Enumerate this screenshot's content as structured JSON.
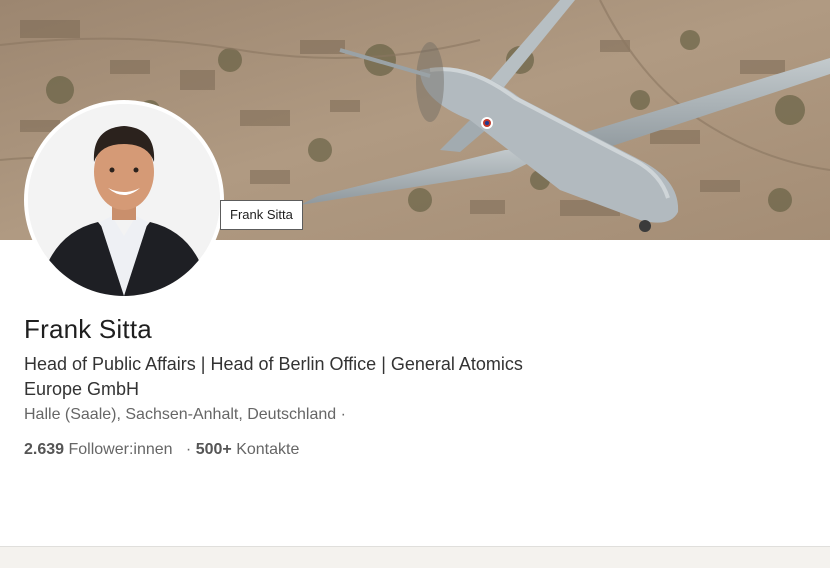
{
  "tooltip": {
    "text": "Frank Sitta"
  },
  "profile": {
    "name": "Frank Sitta",
    "headline": "Head of Public Affairs | Head of Berlin Office | General Atomics Europe GmbH",
    "location": "Halle (Saale), Sachsen-Anhalt, Deutschland ·",
    "followers_count": "2.639",
    "followers_label": "Follower:innen",
    "separator": "·",
    "connections_count": "500+",
    "connections_label": "Kontakte"
  },
  "images": {
    "cover": "cover-photo",
    "avatar": "profile-photo"
  },
  "colors": {
    "text_primary": "#1f1f1f",
    "text_secondary": "#666666",
    "cover_ground": "#a89077",
    "drone_body": "#a9b1b6"
  }
}
